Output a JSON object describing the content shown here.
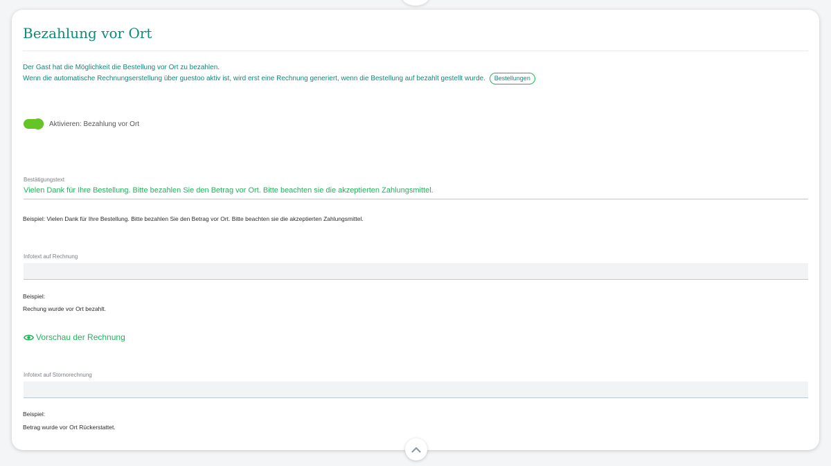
{
  "section": {
    "title": "Bezahlung vor Ort",
    "intro_line1": "Der Gast hat die Möglichkeit die Bestellung vor Ort zu bezahlen.",
    "intro_line2": "Wenn die automatische Rechnungserstellung über guestoo aktiv ist, wird erst eine Rechnung generiert, wenn die Bestellung auf bezahlt gestellt wurde.",
    "orders_button": "Bestellungen"
  },
  "toggle": {
    "label": "Aktivieren: Bezahlung vor Ort",
    "enabled": true
  },
  "confirmation": {
    "label": "Bestätigungstext",
    "value": "Vielen Dank für Ihre Bestellung. Bitte bezahlen Sie den Betrag vor Ort. Bitte beachten sie die akzeptierten Zahlungsmittel.",
    "example": "Beispiel: Vielen Dank für Ihre Bestellung. Bitte bezahlen Sie den Betrag vor Ort. Bitte beachten sie die akzeptierten Zahlungsmittel."
  },
  "invoice_info": {
    "label": "Infotext auf Rechnung",
    "value": "",
    "example_label": "Beispiel:",
    "example_text": "Rechung wurde vor Ort bezahlt."
  },
  "preview": {
    "label": "Vorschau der Rechnung",
    "icon": "eye-icon"
  },
  "cancellation_info": {
    "label": "Infotext auf Stornorechnung",
    "value": "",
    "example_label": "Beispiel:",
    "example_text": "Betrag wurde vor Ort Rückerstattet."
  },
  "colors": {
    "primary_teal": "#0c8a7b",
    "accent_green": "#21b35a",
    "toggle_green": "#66c526"
  }
}
